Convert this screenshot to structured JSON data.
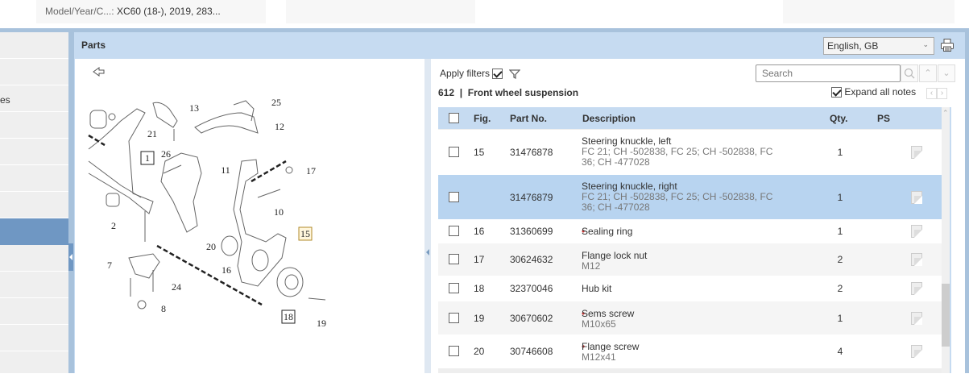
{
  "top": {
    "model_label": "Model/Year/C...:",
    "model_value": "XC60 (18-), 2019, 283..."
  },
  "sidebar": {
    "items": [
      "",
      "",
      "es",
      "",
      "",
      "",
      "",
      "",
      "",
      "",
      "",
      "",
      ""
    ],
    "active_index": 7
  },
  "parts": {
    "title": "Parts",
    "language": "English, GB",
    "apply_filters_label": "Apply filters",
    "apply_filters_checked": true,
    "search_placeholder": "Search",
    "section_number": "612",
    "section_name": "Front wheel suspension",
    "expand_notes_label": "Expand all notes",
    "expand_notes_checked": true
  },
  "diagram": {
    "callouts": [
      "1",
      "2",
      "7",
      "8",
      "10",
      "11",
      "12",
      "13",
      "15",
      "16",
      "17",
      "18",
      "19",
      "20",
      "21",
      "24",
      "25",
      "26"
    ],
    "boxed": [
      "1",
      "15",
      "18"
    ],
    "highlighted": "15"
  },
  "table": {
    "headers": {
      "fig": "Fig.",
      "part_no": "Part No.",
      "description": "Description",
      "qty": "Qty.",
      "ps": "PS"
    },
    "rows": [
      {
        "fig": "15",
        "part_no": "31476878",
        "title": "Steering knuckle, left",
        "bullet": false,
        "note": "FC 21; CH -502838, FC 25; CH -502838, FC 36; CH -477028",
        "qty": "1"
      },
      {
        "fig": "",
        "part_no": "31476879",
        "title": "Steering knuckle, right",
        "bullet": false,
        "note": "FC 21; CH -502838, FC 25; CH -502838, FC 36; CH -477028",
        "qty": "1",
        "selected": true
      },
      {
        "fig": "16",
        "part_no": "31360699",
        "title": "Sealing ring",
        "bullet": true,
        "note": "",
        "qty": "1"
      },
      {
        "fig": "17",
        "part_no": "30624632",
        "title": "Flange lock nut",
        "bullet": false,
        "note": "M12",
        "qty": "2"
      },
      {
        "fig": "18",
        "part_no": "32370046",
        "title": "Hub kit",
        "bullet": false,
        "note": "",
        "qty": "2"
      },
      {
        "fig": "19",
        "part_no": "30670602",
        "title": "Sems screw",
        "bullet": true,
        "note": "M10x65",
        "qty": "1"
      },
      {
        "fig": "20",
        "part_no": "30746608",
        "title": "Flange screw",
        "bullet": true,
        "note": "M12x41",
        "qty": "4"
      }
    ]
  }
}
